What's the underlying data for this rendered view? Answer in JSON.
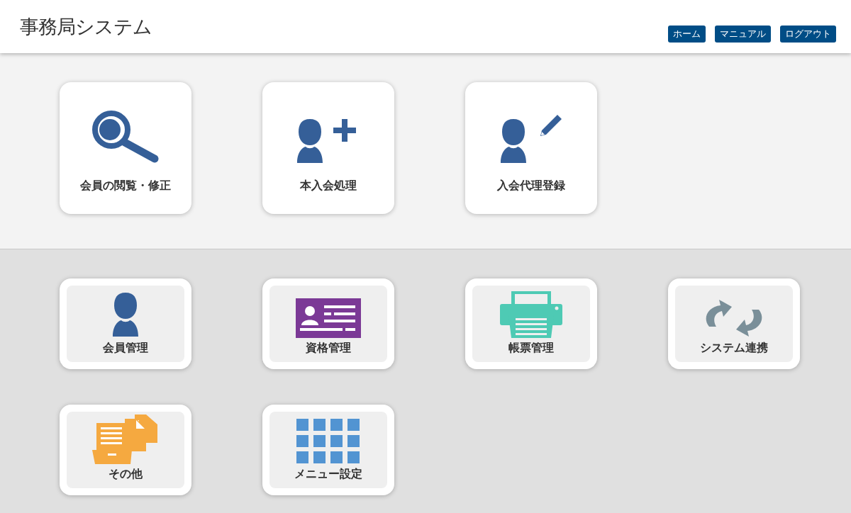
{
  "header": {
    "title": "事務局システム",
    "links": [
      "ホーム",
      "マニュアル",
      "ログアウト"
    ]
  },
  "main_menu": [
    {
      "label": "会員の閲覧・修正",
      "kind": "search"
    },
    {
      "label": "本入会処理",
      "kind": "person-add"
    },
    {
      "label": "入会代理登録",
      "kind": "person-edit"
    }
  ],
  "sub_menu": [
    {
      "label": "会員管理",
      "kind": "person"
    },
    {
      "label": "資格管理",
      "kind": "card"
    },
    {
      "label": "帳票管理",
      "kind": "printer"
    },
    {
      "label": "システム連携",
      "kind": "sync"
    },
    {
      "label": "その他",
      "kind": "files"
    },
    {
      "label": "メニュー設定",
      "kind": "grid"
    }
  ]
}
